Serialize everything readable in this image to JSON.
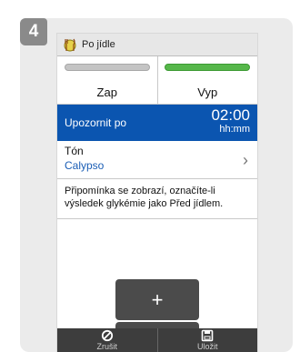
{
  "step": {
    "number": "4"
  },
  "titlebar": {
    "title": "Po jídle",
    "icon": "meal-plate-icon"
  },
  "toggle": {
    "on_label": "Zap",
    "off_label": "Vyp",
    "selected": "Vyp",
    "colors": {
      "active": "#56b74a",
      "inactive": "#c4c4c4"
    }
  },
  "reminder": {
    "label": "Upozornit po",
    "time": "02:00",
    "unit": "hh:mm",
    "highlight_color": "#0b55b0"
  },
  "tone": {
    "label": "Tón",
    "value": "Calypso"
  },
  "note": {
    "text": "Připomínka se zobrazí, označíte-li výsledek glykémie jako Před jídlem."
  },
  "stepper": {
    "plus": "+",
    "minus": "–"
  },
  "bottom": {
    "cancel_label": "Zrušit",
    "save_label": "Uložit",
    "cancel_icon": "cancel-icon",
    "save_icon": "save-icon"
  }
}
